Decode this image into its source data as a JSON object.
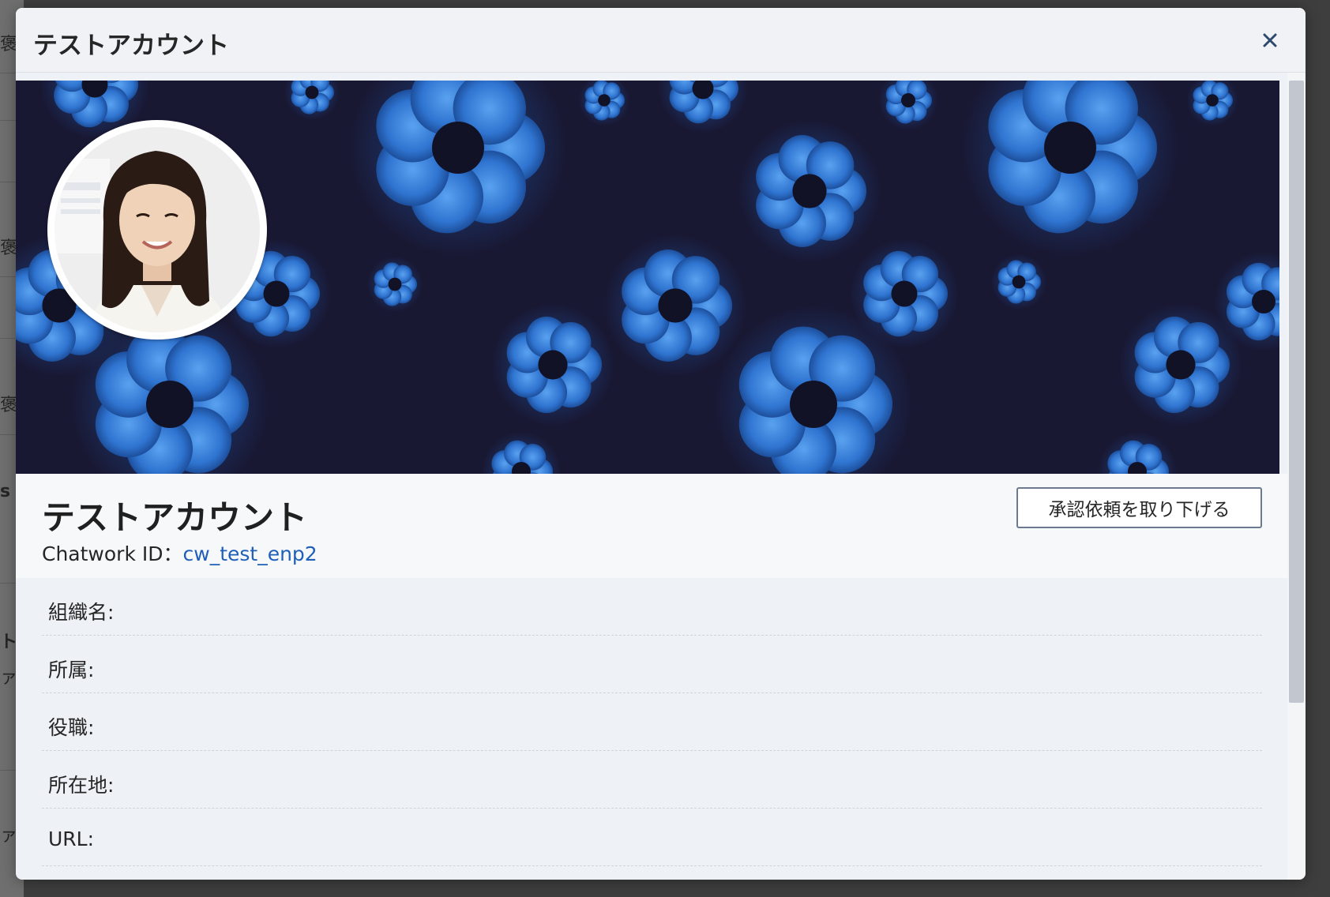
{
  "modal": {
    "title": "テストアカウント",
    "close_icon": "close-icon"
  },
  "background_page": {
    "glyphs": [
      "褒",
      "褒",
      "褒",
      "s",
      "ト",
      "ァ",
      "ァ"
    ]
  },
  "profile": {
    "name": "テストアカウント",
    "chatwork_id_label": "Chatwork ID：",
    "chatwork_id": "cw_test_enp2",
    "withdraw_button_label": "承認依頼を取り下げる",
    "cover_image": "blue-flower-pattern",
    "avatar_image": "profile-photo"
  },
  "fields": [
    {
      "label": "組織名:",
      "value": ""
    },
    {
      "label": "所属:",
      "value": ""
    },
    {
      "label": "役職:",
      "value": ""
    },
    {
      "label": "所在地:",
      "value": ""
    },
    {
      "label": "URL:",
      "value": ""
    }
  ],
  "colors": {
    "link": "#1f5fb8",
    "cover_bg": "#191833",
    "flower": "#2f74d0",
    "overlay": "#3e3e3e"
  }
}
